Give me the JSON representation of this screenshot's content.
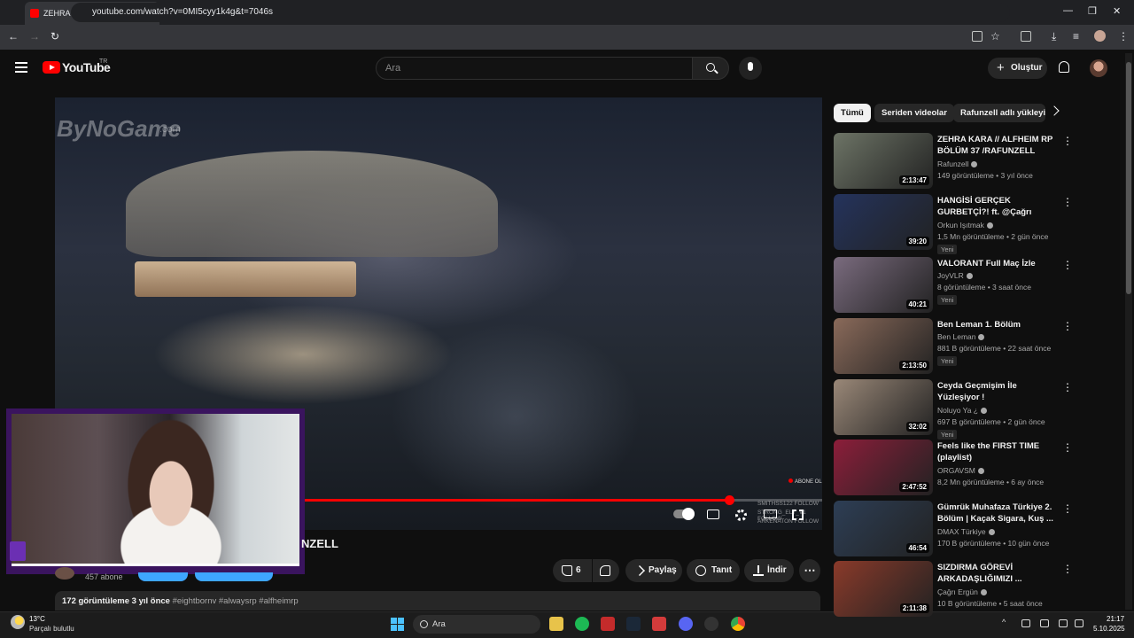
{
  "browser": {
    "tab_title": "ZEHRA KARA // ALFHEIM R",
    "url": "youtube.com/watch?v=0MI5cyy1k4g&t=7046s",
    "new_tab": "+",
    "minimize": "—",
    "restore": "❐",
    "close": "✕",
    "back": "←",
    "forward": "→",
    "reload": "↻",
    "menu": "⋮"
  },
  "header": {
    "logo_text": "YouTube",
    "region": "TR",
    "search_placeholder": "Ara",
    "create_label": "Oluştur",
    "create_plus": "+"
  },
  "video": {
    "watermark": "ByNoGame",
    "watermark_sub": ".com",
    "abone_badge": "ABONE OL",
    "follow_lines": [
      "SMITHSS122  FOLLOW",
      "STRONG_ELY_V1  FOLLOW",
      "ARKENATON  FOLLOW"
    ],
    "progress": 0.879
  },
  "below_video": {
    "title_visible": "NZELL",
    "subscribers": "457 abone",
    "like_count": "6",
    "share_label": "Paylaş",
    "thanks_label": "Tanıt",
    "download_label": "İndir",
    "more_label": "⋯",
    "views_date": "172 görüntüleme  3 yıl önce",
    "hashtags": "#eightbornv #alwaysrp #alfheimrp"
  },
  "chips": [
    {
      "label": "Tümü"
    },
    {
      "label": "Seriden videolar"
    },
    {
      "label": "Rafunzell adlı yükleyi"
    }
  ],
  "recommendations": [
    {
      "title": "ZEHRA KARA // ALFHEIM RP BÖLÜM 37  /RAFUNZELL",
      "channel": "Rafunzell",
      "meta": "149 görüntüleme • 3 yıl önce",
      "duration": "2:13:47",
      "badge": "",
      "color": "#6d7466"
    },
    {
      "title": "HANGİSİ GERÇEK GURBETÇİ?! ft. @Çağrı Ergün",
      "channel": "Orkun Işıtmak",
      "meta": "1,5 Mn görüntüleme • 2 gün önce",
      "duration": "39:20",
      "badge": "Yeni",
      "color": "#24335c"
    },
    {
      "title": "VALORANT Full Maç İzle",
      "channel": "JoyVLR",
      "meta": "8 görüntüleme • 3 saat önce",
      "duration": "40:21",
      "badge": "Yeni",
      "color": "#7a6b7e"
    },
    {
      "title": "Ben Leman 1. Bölüm",
      "channel": "Ben Leman",
      "meta": "881 B görüntüleme • 22 saat önce",
      "duration": "2:13:50",
      "badge": "Yeni",
      "color": "#8a6a5a"
    },
    {
      "title": "Ceyda Geçmişim İle Yüzleşiyor !",
      "channel": "Noluyo Ya ¿",
      "meta": "697 B görüntüleme • 2 gün önce",
      "duration": "32:02",
      "badge": "Yeni",
      "color": "#9a8878"
    },
    {
      "title": "Feels like the FIRST TIME (playlist)",
      "channel": "ORGAVSM",
      "meta": "8,2 Mn görüntüleme • 6 ay önce",
      "duration": "2:47:52",
      "badge": "",
      "color": "#8c1e3a"
    },
    {
      "title": "Gümrük Muhafaza Türkiye 2. Bölüm | Kaçak Sigara, Kuş ...",
      "channel": "DMAX Türkiye",
      "meta": "170 B görüntüleme • 10 gün önce",
      "duration": "46:54",
      "badge": "",
      "color": "#2d3e55"
    },
    {
      "title": "SIZDIRMA GÖREVİ ARKADAŞLIĞIMIZI ...",
      "channel": "Çağrı Ergün",
      "meta": "10 B görüntüleme • 5 saat önce",
      "duration": "2:11:38",
      "badge": "",
      "color": "#8a3a2a"
    }
  ],
  "taskbar": {
    "temperature": "13°C",
    "weather": "Parçalı bulutlu",
    "search_label": "Ara",
    "time": "21:17",
    "date": "5.10.2025"
  }
}
